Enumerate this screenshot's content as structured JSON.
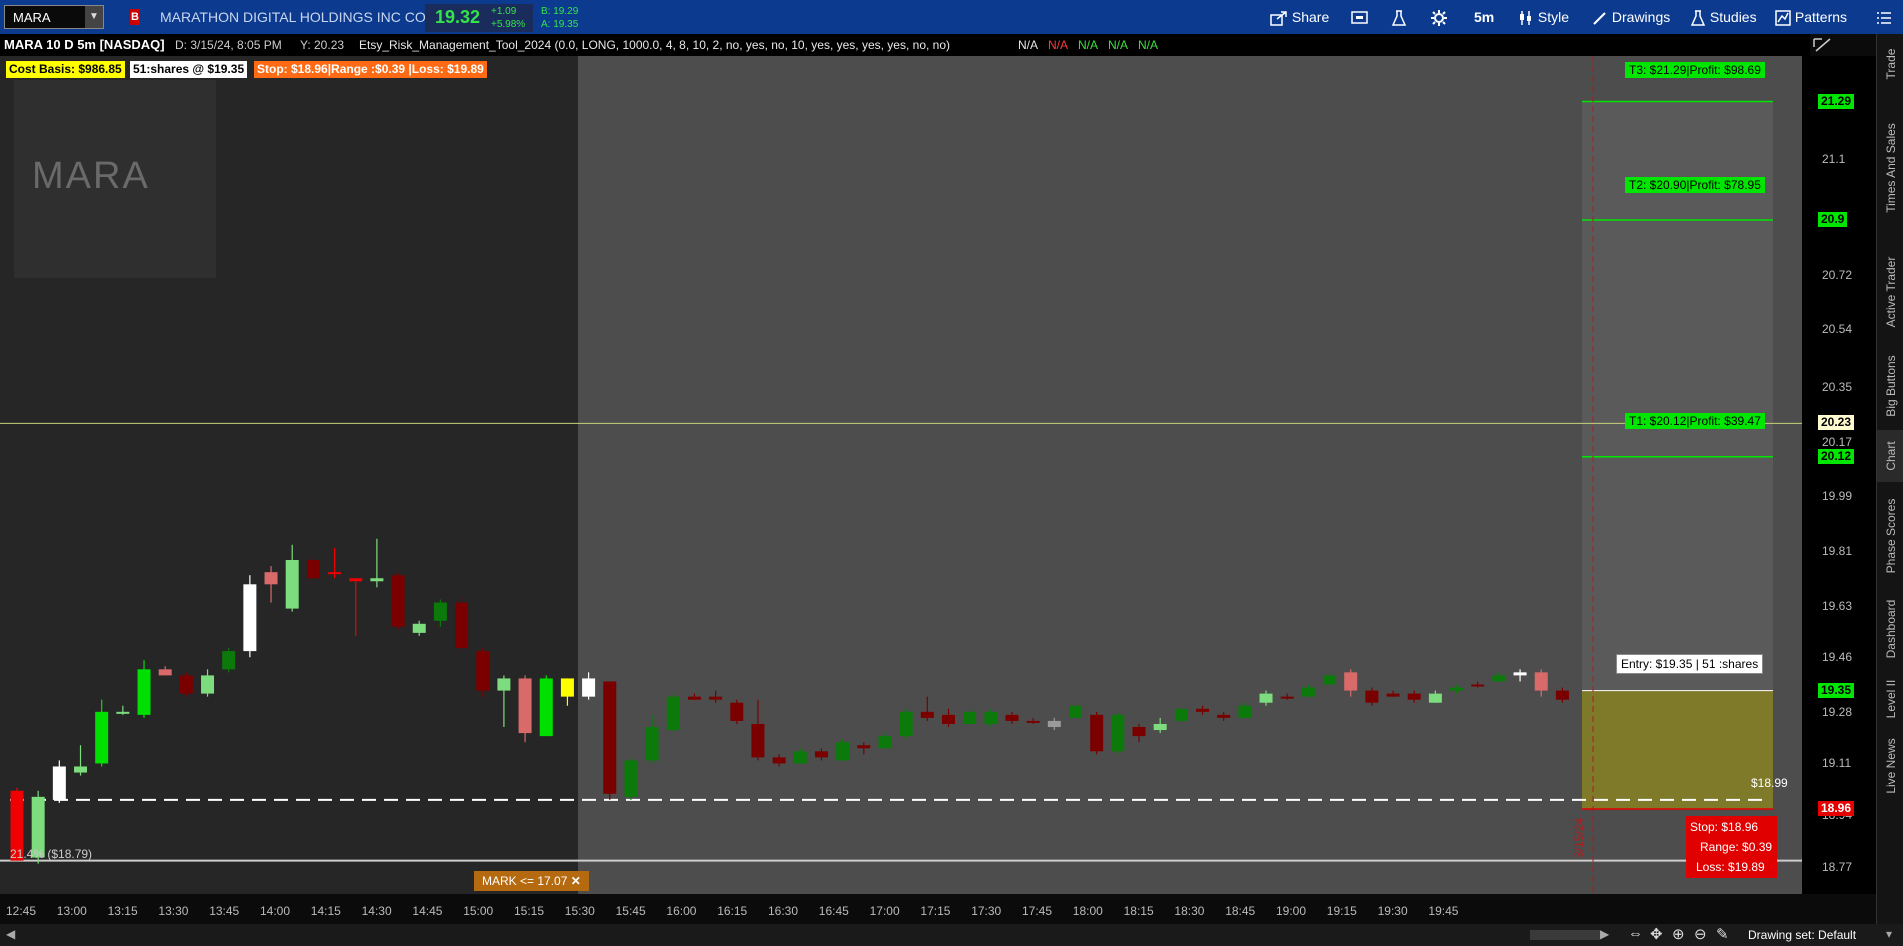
{
  "header": {
    "symbol": "MARA",
    "badge": "B",
    "company": "MARATHON DIGITAL HOLDINGS INC COM",
    "last": "19.32",
    "change": "+1.09",
    "change_pct": "+5.98%",
    "bid": "B: 19.29",
    "ask": "A: 19.35",
    "share": "Share",
    "timeframe": "5m",
    "style": "Style",
    "drawings": "Drawings",
    "studies": "Studies",
    "patterns": "Patterns"
  },
  "info": {
    "title": "MARA 10 D 5m [NASDAQ]",
    "date": "D: 3/15/24, 8:05 PM",
    "y": "Y: 20.23",
    "study": "Etsy_Risk_Management_Tool_2024 (0.0, LONG, 1000.0, 4, 8, 10, 2, no, yes, no, 10, yes, yes, yes, yes, no, no)",
    "na": [
      "N/A",
      "N/A",
      "N/A",
      "N/A",
      "N/A"
    ]
  },
  "chips": {
    "cost": "Cost Basis: $986.85",
    "shares": "51:shares @ $19.35",
    "stop": "Stop: $18.96|Range :$0.39 |Loss: $19.89"
  },
  "watermark": "MARA",
  "targets": {
    "t3": "T3: $21.29|Profit: $98.69",
    "t2": "T2: $20.90|Profit: $78.95",
    "t1": "T1: $20.12|Profit: $39.47",
    "entry": "Entry: $19.35 | 51 :shares",
    "stop1": "Stop: $18.96",
    "stop2": "Range: $0.39",
    "stop3": "Loss: $19.89",
    "dash_label": "$18.99",
    "low_label": "21.4%  ($18.79)",
    "date_vline": "3/15/24"
  },
  "mark": "MARK <= 17.07",
  "price_tags": {
    "t3": "21.29",
    "t2": "20.9",
    "y": "20.23",
    "t1": "20.12",
    "entry": "19.35",
    "stop": "18.96"
  },
  "right_tabs": [
    "Trade",
    "Times And Sales",
    "Active Trader",
    "Big Buttons",
    "Chart",
    "Phase Scores",
    "Dashboard",
    "Level II",
    "Live News"
  ],
  "footer": {
    "drawing_set": "Drawing set: Default"
  },
  "colors": {
    "up_light": "#7ddc7d",
    "up": "#0b7a0b",
    "up_bright": "#00e000",
    "down": "#7a0000",
    "down_light": "#d96a6a",
    "down_bright": "#f00000",
    "target": "#00e600",
    "entry_zone": "#7e7a2a",
    "stop": "#e60000"
  },
  "chart_data": {
    "type": "candlestick",
    "ylim": [
      18.68,
      21.44
    ],
    "y_ticks": [
      21.1,
      20.72,
      20.54,
      20.35,
      20.17,
      19.99,
      19.81,
      19.63,
      19.46,
      19.28,
      19.11,
      18.94,
      18.77
    ],
    "x_ticks": [
      "12:45",
      "13:00",
      "13:15",
      "13:30",
      "13:45",
      "14:00",
      "14:15",
      "14:30",
      "14:45",
      "15:00",
      "15:15",
      "15:30",
      "15:45",
      "16:00",
      "16:15",
      "16:30",
      "16:45",
      "17:00",
      "17:15",
      "17:30",
      "17:45",
      "18:00",
      "18:15",
      "18:30",
      "18:45",
      "19:00",
      "19:15",
      "19:30",
      "19:45"
    ],
    "candles": [
      {
        "o": 19.02,
        "h": 19.03,
        "l": 18.79,
        "c": 18.79,
        "k": "db"
      },
      {
        "o": 18.8,
        "h": 19.02,
        "l": 18.78,
        "c": 19.0,
        "k": "ul"
      },
      {
        "o": 18.99,
        "h": 19.12,
        "l": 18.98,
        "c": 19.1,
        "k": "w"
      },
      {
        "o": 19.08,
        "h": 19.17,
        "l": 19.07,
        "c": 19.1,
        "k": "ul"
      },
      {
        "o": 19.11,
        "h": 19.32,
        "l": 19.1,
        "c": 19.28,
        "k": "ub"
      },
      {
        "o": 19.28,
        "h": 19.3,
        "l": 19.27,
        "c": 19.28,
        "k": "ul"
      },
      {
        "o": 19.27,
        "h": 19.45,
        "l": 19.26,
        "c": 19.42,
        "k": "ub"
      },
      {
        "o": 19.42,
        "h": 19.43,
        "l": 19.4,
        "c": 19.4,
        "k": "dl"
      },
      {
        "o": 19.4,
        "h": 19.41,
        "l": 19.33,
        "c": 19.34,
        "k": "d"
      },
      {
        "o": 19.34,
        "h": 19.42,
        "l": 19.33,
        "c": 19.4,
        "k": "ul"
      },
      {
        "o": 19.42,
        "h": 19.49,
        "l": 19.41,
        "c": 19.48,
        "k": "u"
      },
      {
        "o": 19.48,
        "h": 19.73,
        "l": 19.46,
        "c": 19.7,
        "k": "w"
      },
      {
        "o": 19.7,
        "h": 19.76,
        "l": 19.64,
        "c": 19.74,
        "k": "dl"
      },
      {
        "o": 19.62,
        "h": 19.83,
        "l": 19.61,
        "c": 19.78,
        "k": "ul"
      },
      {
        "o": 19.78,
        "h": 19.79,
        "l": 19.71,
        "c": 19.72,
        "k": "d"
      },
      {
        "o": 19.74,
        "h": 19.82,
        "l": 19.72,
        "c": 19.74,
        "k": "db"
      },
      {
        "o": 19.72,
        "h": 19.72,
        "l": 19.53,
        "c": 19.71,
        "k": "db"
      },
      {
        "o": 19.71,
        "h": 19.85,
        "l": 19.69,
        "c": 19.72,
        "k": "ul"
      },
      {
        "o": 19.73,
        "h": 19.74,
        "l": 19.55,
        "c": 19.56,
        "k": "d"
      },
      {
        "o": 19.54,
        "h": 19.58,
        "l": 19.53,
        "c": 19.57,
        "k": "ul"
      },
      {
        "o": 19.58,
        "h": 19.65,
        "l": 19.56,
        "c": 19.64,
        "k": "u"
      },
      {
        "o": 19.64,
        "h": 19.66,
        "l": 19.48,
        "c": 19.49,
        "k": "d"
      },
      {
        "o": 19.48,
        "h": 19.49,
        "l": 19.33,
        "c": 19.35,
        "k": "d"
      },
      {
        "o": 19.35,
        "h": 19.4,
        "l": 19.23,
        "c": 19.39,
        "k": "ul"
      },
      {
        "o": 19.39,
        "h": 19.4,
        "l": 19.18,
        "c": 19.21,
        "k": "dl"
      },
      {
        "o": 19.2,
        "h": 19.4,
        "l": 19.2,
        "c": 19.39,
        "k": "ub"
      },
      {
        "o": 19.39,
        "h": 19.39,
        "l": 19.3,
        "c": 19.33,
        "k": "y"
      },
      {
        "o": 19.33,
        "h": 19.41,
        "l": 19.32,
        "c": 19.39,
        "k": "w"
      },
      {
        "o": 19.38,
        "h": 19.38,
        "l": 18.99,
        "c": 19.01,
        "k": "d"
      },
      {
        "o": 19.0,
        "h": 19.13,
        "l": 18.99,
        "c": 19.12,
        "k": "u"
      },
      {
        "o": 19.12,
        "h": 19.27,
        "l": 19.11,
        "c": 19.23,
        "k": "u"
      },
      {
        "o": 19.22,
        "h": 19.34,
        "l": 19.21,
        "c": 19.33,
        "k": "u"
      },
      {
        "o": 19.33,
        "h": 19.34,
        "l": 19.32,
        "c": 19.32,
        "k": "d"
      },
      {
        "o": 19.33,
        "h": 19.35,
        "l": 19.31,
        "c": 19.32,
        "k": "d"
      },
      {
        "o": 19.31,
        "h": 19.32,
        "l": 19.24,
        "c": 19.25,
        "k": "d"
      },
      {
        "o": 19.24,
        "h": 19.32,
        "l": 19.12,
        "c": 19.13,
        "k": "d"
      },
      {
        "o": 19.13,
        "h": 19.14,
        "l": 19.1,
        "c": 19.11,
        "k": "d"
      },
      {
        "o": 19.11,
        "h": 19.16,
        "l": 19.11,
        "c": 19.15,
        "k": "u"
      },
      {
        "o": 19.15,
        "h": 19.16,
        "l": 19.12,
        "c": 19.13,
        "k": "d"
      },
      {
        "o": 19.12,
        "h": 19.19,
        "l": 19.12,
        "c": 19.18,
        "k": "u"
      },
      {
        "o": 19.17,
        "h": 19.18,
        "l": 19.14,
        "c": 19.16,
        "k": "d"
      },
      {
        "o": 19.16,
        "h": 19.21,
        "l": 19.16,
        "c": 19.2,
        "k": "u"
      },
      {
        "o": 19.2,
        "h": 19.29,
        "l": 19.19,
        "c": 19.28,
        "k": "u"
      },
      {
        "o": 19.28,
        "h": 19.33,
        "l": 19.25,
        "c": 19.26,
        "k": "d"
      },
      {
        "o": 19.27,
        "h": 19.29,
        "l": 19.23,
        "c": 19.24,
        "k": "d"
      },
      {
        "o": 19.24,
        "h": 19.29,
        "l": 19.24,
        "c": 19.28,
        "k": "u"
      },
      {
        "o": 19.24,
        "h": 19.29,
        "l": 19.23,
        "c": 19.28,
        "k": "u"
      },
      {
        "o": 19.27,
        "h": 19.28,
        "l": 19.24,
        "c": 19.25,
        "k": "d"
      },
      {
        "o": 19.25,
        "h": 19.26,
        "l": 19.24,
        "c": 19.25,
        "k": "d"
      },
      {
        "o": 19.23,
        "h": 19.26,
        "l": 19.22,
        "c": 19.25,
        "k": "g"
      },
      {
        "o": 19.26,
        "h": 19.31,
        "l": 19.26,
        "c": 19.3,
        "k": "u"
      },
      {
        "o": 19.27,
        "h": 19.28,
        "l": 19.14,
        "c": 19.15,
        "k": "d"
      },
      {
        "o": 19.15,
        "h": 19.28,
        "l": 19.14,
        "c": 19.27,
        "k": "u"
      },
      {
        "o": 19.23,
        "h": 19.24,
        "l": 19.18,
        "c": 19.2,
        "k": "d"
      },
      {
        "o": 19.22,
        "h": 19.26,
        "l": 19.21,
        "c": 19.24,
        "k": "ul"
      },
      {
        "o": 19.25,
        "h": 19.29,
        "l": 19.24,
        "c": 19.29,
        "k": "u"
      },
      {
        "o": 19.29,
        "h": 19.3,
        "l": 19.27,
        "c": 19.28,
        "k": "d"
      },
      {
        "o": 19.27,
        "h": 19.28,
        "l": 19.25,
        "c": 19.26,
        "k": "d"
      },
      {
        "o": 19.26,
        "h": 19.31,
        "l": 19.26,
        "c": 19.3,
        "k": "u"
      },
      {
        "o": 19.31,
        "h": 19.35,
        "l": 19.3,
        "c": 19.34,
        "k": "ul"
      },
      {
        "o": 19.33,
        "h": 19.34,
        "l": 19.32,
        "c": 19.33,
        "k": "d"
      },
      {
        "o": 19.33,
        "h": 19.37,
        "l": 19.33,
        "c": 19.36,
        "k": "u"
      },
      {
        "o": 19.37,
        "h": 19.41,
        "l": 19.37,
        "c": 19.4,
        "k": "u"
      },
      {
        "o": 19.41,
        "h": 19.42,
        "l": 19.33,
        "c": 19.35,
        "k": "dl"
      },
      {
        "o": 19.35,
        "h": 19.36,
        "l": 19.3,
        "c": 19.31,
        "k": "d"
      },
      {
        "o": 19.34,
        "h": 19.35,
        "l": 19.33,
        "c": 19.33,
        "k": "d"
      },
      {
        "o": 19.34,
        "h": 19.35,
        "l": 19.31,
        "c": 19.32,
        "k": "d"
      },
      {
        "o": 19.31,
        "h": 19.35,
        "l": 19.31,
        "c": 19.34,
        "k": "ul"
      },
      {
        "o": 19.35,
        "h": 19.37,
        "l": 19.34,
        "c": 19.36,
        "k": "u"
      },
      {
        "o": 19.37,
        "h": 19.38,
        "l": 19.36,
        "c": 19.37,
        "k": "d"
      },
      {
        "o": 19.38,
        "h": 19.41,
        "l": 19.38,
        "c": 19.4,
        "k": "u"
      },
      {
        "o": 19.4,
        "h": 19.42,
        "l": 19.38,
        "c": 19.41,
        "k": "w"
      },
      {
        "o": 19.41,
        "h": 19.42,
        "l": 19.33,
        "c": 19.35,
        "k": "dl"
      },
      {
        "o": 19.35,
        "h": 19.36,
        "l": 19.31,
        "c": 19.32,
        "k": "d"
      }
    ],
    "levels": {
      "t3": 21.29,
      "t2": 20.9,
      "y": 20.23,
      "t1": 20.12,
      "entry": 19.35,
      "stop": 18.96,
      "dash": 18.99,
      "low": 18.79
    }
  }
}
